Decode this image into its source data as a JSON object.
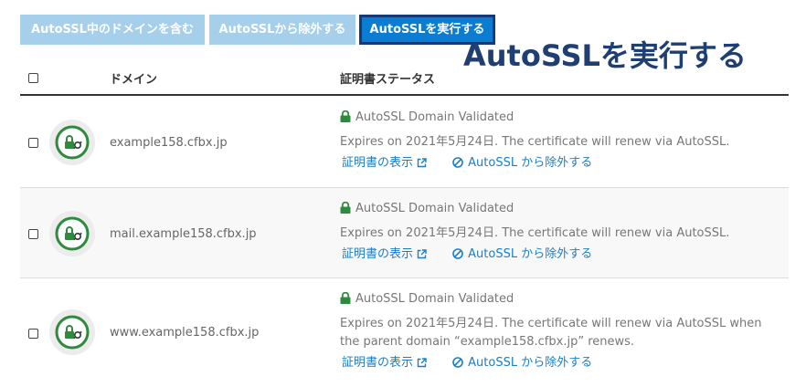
{
  "toolbar": {
    "include_label": "AutoSSL中のドメインを含む",
    "exclude_label": "AutoSSLから除外する",
    "run_label": "AutoSSLを実行する"
  },
  "callout": "AutoSSLを実行する",
  "table": {
    "headers": {
      "domain": "ドメイン",
      "status": "証明書ステータス"
    },
    "rows": [
      {
        "domain": "example158.cfbx.jp",
        "status": "AutoSSL Domain Validated",
        "expires": "Expires on 2021年5月24日. The certificate will renew via AutoSSL.",
        "view_link": "証明書の表示",
        "exclude_link": "AutoSSL から除外する"
      },
      {
        "domain": "mail.example158.cfbx.jp",
        "status": "AutoSSL Domain Validated",
        "expires": "Expires on 2021年5月24日. The certificate will renew via AutoSSL.",
        "view_link": "証明書の表示",
        "exclude_link": "AutoSSL から除外する"
      },
      {
        "domain": "www.example158.cfbx.jp",
        "status": "AutoSSL Domain Validated",
        "expires": "Expires on 2021年5月24日. The certificate will renew via AutoSSL when the parent domain “example158.cfbx.jp” renews.",
        "view_link": "証明書の表示",
        "exclude_link": "AutoSSL から除外する"
      }
    ]
  },
  "colors": {
    "primary": "#0a7dd2",
    "disabled": "#a5cfeb",
    "link": "#1a7ec8",
    "valid_green": "#2e8b3e",
    "callout": "#1f3f73"
  },
  "icons": {
    "cert": "certificate-lock-icon",
    "lock": "lock-icon",
    "external": "external-link-icon",
    "ban": "ban-icon"
  }
}
